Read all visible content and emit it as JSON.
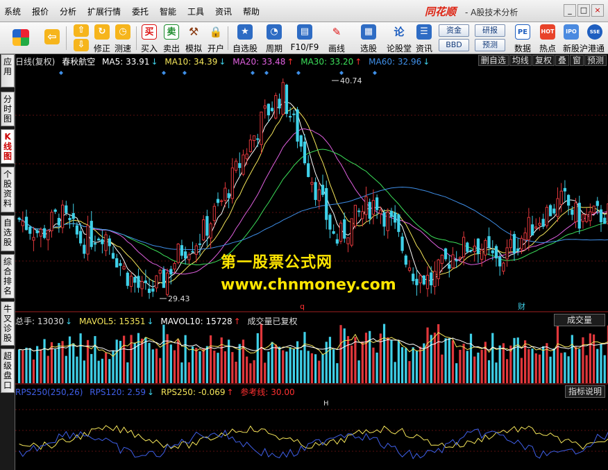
{
  "menu": {
    "items": [
      "系统",
      "报价",
      "分析",
      "扩展行情",
      "委托",
      "智能",
      "工具",
      "资讯",
      "帮助"
    ],
    "brand": "同花顺",
    "subtitle": "- A股技术分析",
    "win_min": "_",
    "win_max": "□",
    "win_close": "×"
  },
  "toolbar": {
    "buttons": [
      {
        "label": "",
        "icon": "windows-logo-icon"
      },
      {
        "label": "",
        "icon": "back-arrow-icon"
      },
      {
        "label": "修正",
        "icon": "refresh-icon"
      },
      {
        "label": "测速",
        "icon": "clock-icon"
      },
      {
        "label": "买入",
        "icon": "buy-icon",
        "glyph": "买"
      },
      {
        "label": "卖出",
        "icon": "sell-icon",
        "glyph": "卖"
      },
      {
        "label": "模拟",
        "icon": "hammer-icon"
      },
      {
        "label": "开户",
        "icon": "lock-icon"
      },
      {
        "label": "自选股",
        "icon": "star-icon"
      },
      {
        "label": "周期",
        "icon": "period-icon"
      },
      {
        "label": "F10/F9",
        "icon": "f10-icon"
      },
      {
        "label": "画线",
        "icon": "pencil-icon"
      },
      {
        "label": "选股",
        "icon": "screen-icon"
      },
      {
        "label": "论股堂",
        "icon": "discuss-icon",
        "glyph": "论"
      },
      {
        "label": "资讯",
        "icon": "news-icon"
      },
      {
        "label": "数据",
        "icon": "pe-icon",
        "glyph": "PE"
      },
      {
        "label": "热点",
        "icon": "hot-icon",
        "glyph": "HOT"
      },
      {
        "label": "新股",
        "icon": "ipo-icon",
        "glyph": "IPO"
      },
      {
        "label": "沪港通",
        "icon": "hk-connect-icon",
        "glyph": "SSE"
      }
    ],
    "pills": [
      "资金",
      "研报",
      "BBD",
      "预测"
    ]
  },
  "sidetabs": [
    "应用",
    "分时图",
    "K线图",
    "个股资料",
    "自选股",
    "综合排名",
    "牛叉诊股",
    "超级盘口"
  ],
  "kline": {
    "period": "日线(复权)",
    "stock": "春秋航空",
    "ma5_label": "MA5: 33.91",
    "ma10_label": "MA10: 34.39",
    "ma20_label": "MA20: 33.48",
    "ma30_label": "MA30: 33.20",
    "ma60_label": "MA60: 32.96",
    "down": "↓",
    "up": "↑",
    "high_label": "40.74",
    "low_label": "29.43",
    "marker_q": "q",
    "marker_cai": "财",
    "tools": [
      "删自选",
      "均线",
      "复权",
      "叠",
      "窗",
      "预测"
    ],
    "colors": {
      "up": "#e0373b",
      "down": "#3fd0e8",
      "ma5": "#ffffff",
      "ma10": "#f5e65a",
      "ma20": "#e060e0",
      "ma30": "#3ce05a",
      "ma60": "#3f8fe8"
    }
  },
  "volume": {
    "total_label": "总手: 13030",
    "mavol5_label": "MAVOL5: 15351",
    "mavol10_label": "MAVOL10: 15728",
    "note": "成交量已复权",
    "button": "成交量"
  },
  "rps": {
    "rps250_label": "RPS250(250,26)",
    "rps120_label": "RPS120: 2.59",
    "rps250_value": "RPS250: -0.069",
    "ref_label": "参考线: 30.00",
    "button": "指标说明",
    "marker": "H"
  },
  "watermark": {
    "line1": "第一股票公式网",
    "line2": "www.chnmoney.com"
  }
}
